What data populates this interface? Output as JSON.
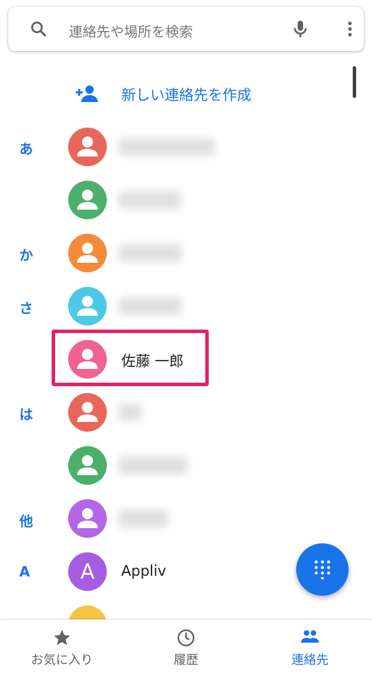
{
  "search": {
    "placeholder": "連絡先や場所を検索"
  },
  "create_contact_label": "新しい連絡先を作成",
  "sections": [
    {
      "letter": "あ"
    },
    {
      "letter": "か"
    },
    {
      "letter": "さ"
    },
    {
      "letter": "は"
    },
    {
      "letter": "他"
    },
    {
      "letter": "A"
    }
  ],
  "contacts": [
    {
      "name": "",
      "color": "#e8675a",
      "blurred": true
    },
    {
      "name": "",
      "color": "#4caf6a",
      "blurred": true
    },
    {
      "name": "",
      "color": "#f28c3b",
      "blurred": true
    },
    {
      "name": "",
      "color": "#4dc9e6",
      "blurred": true
    },
    {
      "name": "佐藤 一郎",
      "color": "#f06292",
      "blurred": false,
      "highlighted": true
    },
    {
      "name": "",
      "color": "#e8675a",
      "blurred": true
    },
    {
      "name": "",
      "color": "#4caf6a",
      "blurred": true
    },
    {
      "name": "",
      "color": "#b366e6",
      "blurred": true
    },
    {
      "name": "Appliv",
      "color": "#a65de0",
      "blurred": false,
      "avatar_letter": "A"
    },
    {
      "name": "",
      "color": "#f6c443",
      "blurred": false
    }
  ],
  "colors": {
    "accent": "#1a73e8",
    "highlight": "#e91e63"
  },
  "bottom_nav": {
    "favorites": "お気に入り",
    "history": "履歴",
    "contacts": "連絡先"
  }
}
